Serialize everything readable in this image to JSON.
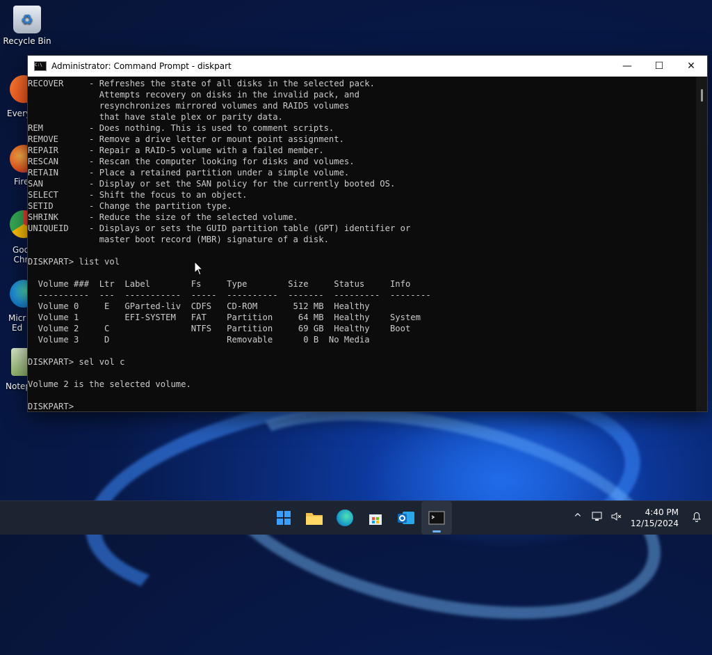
{
  "desktop": {
    "icons": [
      {
        "label": "Recycle Bin"
      },
      {
        "label": "Every"
      },
      {
        "label": "Fire"
      },
      {
        "label": "Goo\nChr"
      },
      {
        "label": "Micr\nEd"
      },
      {
        "label": "Notep"
      }
    ]
  },
  "window": {
    "title": "Administrator: Command Prompt - diskpart",
    "controls": {
      "minimize": "—",
      "maximize": "☐",
      "close": "✕"
    }
  },
  "console": {
    "lines": [
      "RECOVER     - Refreshes the state of all disks in the selected pack.",
      "              Attempts recovery on disks in the invalid pack, and",
      "              resynchronizes mirrored volumes and RAID5 volumes",
      "              that have stale plex or parity data.",
      "REM         - Does nothing. This is used to comment scripts.",
      "REMOVE      - Remove a drive letter or mount point assignment.",
      "REPAIR      - Repair a RAID-5 volume with a failed member.",
      "RESCAN      - Rescan the computer looking for disks and volumes.",
      "RETAIN      - Place a retained partition under a simple volume.",
      "SAN         - Display or set the SAN policy for the currently booted OS.",
      "SELECT      - Shift the focus to an object.",
      "SETID       - Change the partition type.",
      "SHRINK      - Reduce the size of the selected volume.",
      "UNIQUEID    - Displays or sets the GUID partition table (GPT) identifier or",
      "              master boot record (MBR) signature of a disk.",
      "",
      "DISKPART> list vol",
      "",
      "  Volume ###  Ltr  Label        Fs     Type        Size     Status     Info",
      "  ----------  ---  -----------  -----  ----------  -------  ---------  --------",
      "  Volume 0     E   GParted-liv  CDFS   CD-ROM       512 MB  Healthy",
      "  Volume 1         EFI-SYSTEM   FAT    Partition     64 MB  Healthy    System",
      "  Volume 2     C                NTFS   Partition     69 GB  Healthy    Boot",
      "  Volume 3     D                       Removable      0 B  No Media",
      "",
      "DISKPART> sel vol c",
      "",
      "Volume 2 is the selected volume.",
      "",
      "DISKPART>"
    ]
  },
  "taskbar": {
    "apps": [
      {
        "name": "start",
        "color": "#3aa0ff"
      },
      {
        "name": "file-explorer",
        "color": "#f2c14e"
      },
      {
        "name": "edge",
        "color": "#1fa3c8"
      },
      {
        "name": "store",
        "color": "#2f7bd6"
      },
      {
        "name": "outlook",
        "color": "#0f6cbd"
      },
      {
        "name": "terminal",
        "color": "#2b2b2b"
      }
    ],
    "tray": {
      "chevron": "^",
      "time": "4:40 PM",
      "date": "12/15/2024"
    }
  }
}
